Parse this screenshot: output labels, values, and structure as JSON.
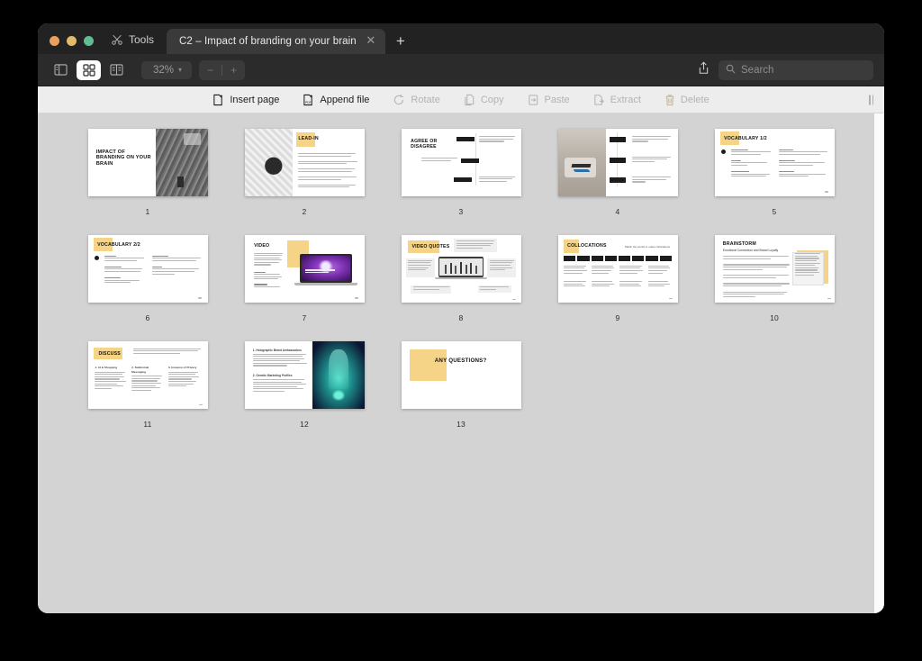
{
  "window": {
    "traffic_lights": [
      "close",
      "minimize",
      "zoom"
    ],
    "tools_label": "Tools",
    "tools_icon": "tools-scissors-icon",
    "tab_title": "C2 – Impact of branding on your brain",
    "tab_close_icon": "close-icon",
    "new_tab_icon": "plus-icon"
  },
  "toolbar": {
    "view_modes": [
      {
        "name": "single-page-view",
        "icon": "sidebar-view-icon",
        "active": false
      },
      {
        "name": "thumbnail-grid-view",
        "icon": "grid-view-icon",
        "active": true
      },
      {
        "name": "split-view",
        "icon": "split-view-icon",
        "active": false
      }
    ],
    "zoom_level": "32%",
    "zoom_caret": "▾",
    "zoom_out": "−",
    "zoom_in": "+",
    "share_icon": "share-icon",
    "search_icon": "search-icon",
    "search_placeholder": "Search",
    "search_value": ""
  },
  "actions": [
    {
      "label": "Insert page",
      "icon": "insert-page-icon",
      "enabled": true
    },
    {
      "label": "Append file",
      "icon": "append-file-icon",
      "enabled": true
    },
    {
      "label": "Rotate",
      "icon": "rotate-icon",
      "enabled": false
    },
    {
      "label": "Copy",
      "icon": "copy-icon",
      "enabled": false
    },
    {
      "label": "Paste",
      "icon": "paste-icon",
      "enabled": false
    },
    {
      "label": "Extract",
      "icon": "extract-icon",
      "enabled": false
    },
    {
      "label": "Delete",
      "icon": "trash-icon",
      "enabled": false
    }
  ],
  "colors": {
    "accent_yellow": "#f5d488",
    "canvas_grey": "#d3d3d3",
    "titlebar_dark": "#222222",
    "toolbar_dark": "#2b2b2b",
    "actionbar_light": "#ededed"
  },
  "pages": [
    {
      "number": "1",
      "layout": "title-photo",
      "title": "IMPACT OF BRANDING ON YOUR BRAIN"
    },
    {
      "number": "2",
      "layout": "photo-left-list",
      "title": "LEAD-IN"
    },
    {
      "number": "3",
      "layout": "agree-disagree",
      "title": "AGREE OR DISAGREE"
    },
    {
      "number": "4",
      "layout": "photo-left-steps",
      "title": ""
    },
    {
      "number": "5",
      "layout": "vocabulary",
      "title": "VOCABULARY 1/2"
    },
    {
      "number": "6",
      "layout": "vocabulary",
      "title": "VOCABULARY 2/2"
    },
    {
      "number": "7",
      "layout": "video",
      "title": "VIDEO"
    },
    {
      "number": "8",
      "layout": "video-quotes",
      "title": "VIDEO QUOTES"
    },
    {
      "number": "9",
      "layout": "collocations",
      "title": "COLLOCATIONS",
      "subtitle": "Match the words to make collocations"
    },
    {
      "number": "10",
      "layout": "brainstorm",
      "title": "BRAINSTORM",
      "subtitle": "Emotional Connection and Brand Loyalty"
    },
    {
      "number": "11",
      "layout": "discuss",
      "title": "DISCUSS",
      "columns": [
        "1. AI & Shopping",
        "2. Subliminal Messaging",
        "3. Invasion of Privacy"
      ]
    },
    {
      "number": "12",
      "layout": "two-sections-photo",
      "title": "",
      "columns": [
        "1. Holographic Brand Ambassadors",
        "2. Genetic Marketing Profiles"
      ]
    },
    {
      "number": "13",
      "layout": "closing",
      "title": "ANY QUESTIONS?"
    }
  ]
}
